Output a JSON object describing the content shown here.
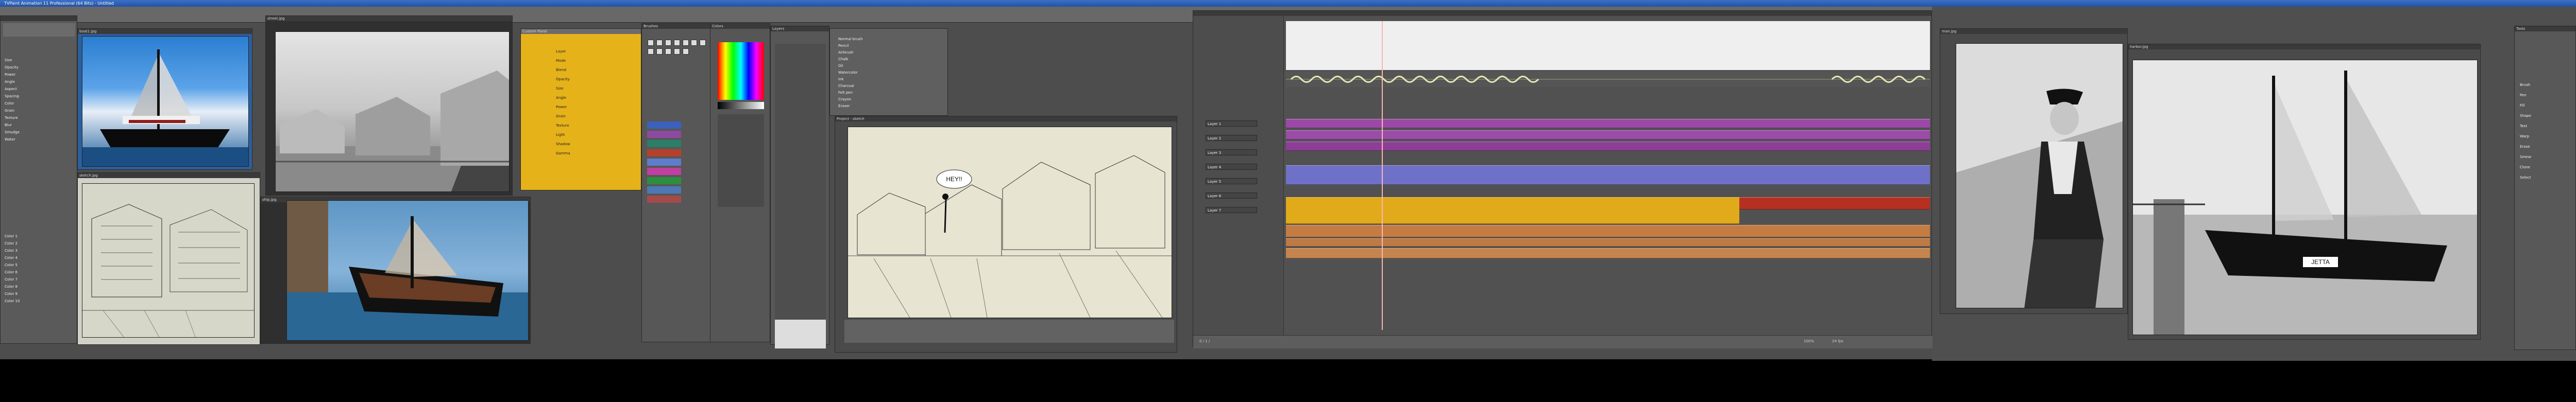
{
  "window": {
    "title": "TVPaint Animation 11 Professional (64 Bits) - Untitled"
  },
  "app_colors": {
    "accent_yellow": "#e6b21a",
    "track_purple": "#9a4aa6",
    "track_blue": "#6f71c8",
    "track_orange": "#c87f43",
    "panel_gray": "#5b5b5b"
  },
  "left_panel": {
    "rows": [
      "Size",
      "Opacity",
      "Power",
      "Angle",
      "Aspect",
      "Spacing",
      "Color",
      "Grain",
      "Texture",
      "Blur",
      "Smudge",
      "Water"
    ],
    "color_rows": [
      "Color 1",
      "Color 2",
      "Color 3",
      "Color 4",
      "Color 5",
      "Color 6",
      "Color 7",
      "Color 8",
      "Color 9",
      "Color 10"
    ]
  },
  "image_windows": {
    "boat_title": "boat1.jpg",
    "street_title": "street.jpg",
    "sketch_title": "sketch.jpg",
    "ship_title": "ship.jpg"
  },
  "yellow_panel": {
    "title": "Custom Panel",
    "rows": [
      "Layer",
      "Mode",
      "Blend",
      "Opacity",
      "Size",
      "Angle",
      "Power",
      "Grain",
      "Texture",
      "Light",
      "Shadow",
      "Gamma"
    ]
  },
  "tool_panels": {
    "brush_title": "Brushes",
    "colors_title": "Colors",
    "layers_title": "Layers",
    "list_items": [
      "Normal brush",
      "Pencil",
      "Airbrush",
      "Chalk",
      "Oil",
      "Watercolor",
      "Ink",
      "Charcoal",
      "Felt pen",
      "Crayon",
      "Eraser"
    ]
  },
  "canvas": {
    "title": "Project - sketch",
    "speech": "HEY!!"
  },
  "timeline": {
    "layers": [
      "Layer 1",
      "Layer 2",
      "Layer 3",
      "Layer 4",
      "Layer 5",
      "Layer 6",
      "Layer 7"
    ],
    "status_left": "0 / 1 /",
    "status_zoom": "100%",
    "status_fps": "24 fps"
  },
  "right_windows": {
    "man_title": "man.jpg",
    "harbor_title": "harbor.jpg",
    "sign_text": "JETTA"
  },
  "right_panel": {
    "title": "Tools",
    "rows": [
      "Brush",
      "Pen",
      "Fill",
      "Shape",
      "Text",
      "Warp",
      "Erase",
      "Smear",
      "Clone",
      "Select"
    ]
  }
}
